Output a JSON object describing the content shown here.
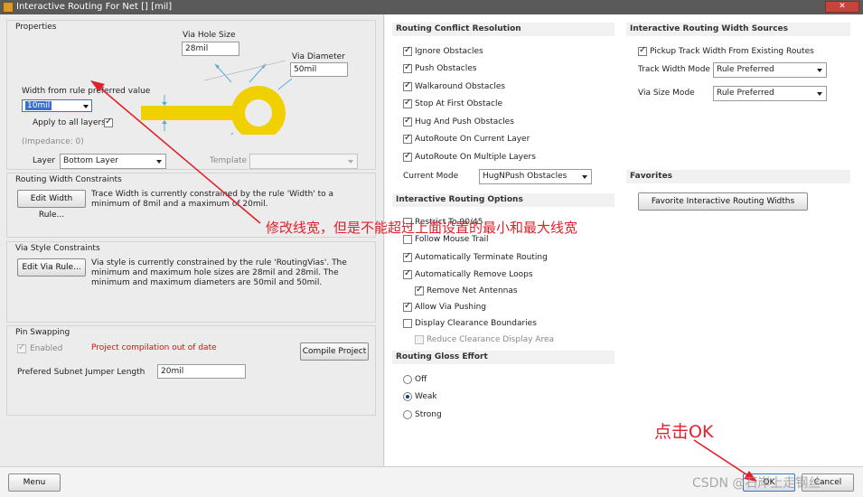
{
  "window": {
    "title": "Interactive Routing For Net [] [mil]",
    "close_glyph": "✕"
  },
  "properties": {
    "title": "Properties",
    "via_hole_size_label": "Via Hole Size",
    "via_hole_size_value": "28mil",
    "via_diameter_label": "Via Diameter",
    "via_diameter_value": "50mil",
    "width_label": "Width from rule preferred value",
    "width_value": "10mil",
    "apply_all_layers_label": "Apply to all layers",
    "apply_all_layers_checked": true,
    "impedance_label": "(Impedance: 0)",
    "layer_label": "Layer",
    "layer_value": "Bottom Layer",
    "template_label": "Template",
    "template_value": ""
  },
  "width_constraints": {
    "title": "Routing Width Constraints",
    "button_label": "Edit Width Rule...",
    "description": "Trace Width is currently constrained by the rule 'Width' to a minimum of 8mil and a maximum of 20mil."
  },
  "via_constraints": {
    "title": "Via Style Constraints",
    "button_label": "Edit Via Rule...",
    "description": "Via style is currently constrained by the rule 'RoutingVias'. The minimum and maximum hole sizes are 28mil and 28mil. The minimum and maximum diameters are 50mil and 50mil."
  },
  "pin_swapping": {
    "title": "Pin Swapping",
    "enabled_label": "Enabled",
    "enabled_checked": true,
    "warning": "Project compilation out of date",
    "compile_button": "Compile Project",
    "subnet_label": "Prefered Subnet Jumper Length",
    "subnet_value": "20mil"
  },
  "conflict_resolution": {
    "title": "Routing Conflict Resolution",
    "options": [
      {
        "label": "Ignore Obstacles",
        "checked": true
      },
      {
        "label": "Push Obstacles",
        "checked": true
      },
      {
        "label": "Walkaround Obstacles",
        "checked": true
      },
      {
        "label": "Stop At First Obstacle",
        "checked": true
      },
      {
        "label": "Hug And Push Obstacles",
        "checked": true
      },
      {
        "label": "AutoRoute On Current Layer",
        "checked": true
      },
      {
        "label": "AutoRoute On Multiple Layers",
        "checked": true
      }
    ],
    "mode_label": "Current Mode",
    "mode_value": "HugNPush Obstacles"
  },
  "routing_options": {
    "title": "Interactive Routing Options",
    "options": [
      {
        "label": "Restrict To 90/45",
        "checked": false
      },
      {
        "label": "Follow Mouse Trail",
        "checked": false
      },
      {
        "label": "Automatically Terminate Routing",
        "checked": true
      },
      {
        "label": "Automatically Remove Loops",
        "checked": true
      },
      {
        "label": "Remove Net Antennas",
        "checked": true
      },
      {
        "label": "Allow Via Pushing",
        "checked": true
      },
      {
        "label": "Display Clearance Boundaries",
        "checked": false
      },
      {
        "label": "Reduce Clearance Display Area",
        "checked": false
      }
    ]
  },
  "gloss_effort": {
    "title": "Routing Gloss Effort",
    "options": [
      {
        "label": "Off",
        "selected": false
      },
      {
        "label": "Weak",
        "selected": true
      },
      {
        "label": "Strong",
        "selected": false
      }
    ]
  },
  "width_sources": {
    "title": "Interactive Routing Width Sources",
    "pickup_label": "Pickup Track Width From Existing Routes",
    "pickup_checked": true,
    "track_mode_label": "Track Width Mode",
    "track_mode_value": "Rule Preferred",
    "via_mode_label": "Via Size Mode",
    "via_mode_value": "Rule Preferred"
  },
  "favorites": {
    "title": "Favorites",
    "button_label": "Favorite Interactive Routing Widths"
  },
  "footer": {
    "menu_button": "Menu",
    "ok_button": "OK",
    "cancel_button": "Cancel"
  },
  "annotations": {
    "note_width": "修改线宽，但是不能超过上面设置的最小和最大线宽",
    "note_ok": "点击OK",
    "watermark": "CSDN @石岸上走钢丝"
  },
  "colors": {
    "annotation": "#e0202a",
    "via_graphic": "#f0d000",
    "warning": "#d01010"
  }
}
